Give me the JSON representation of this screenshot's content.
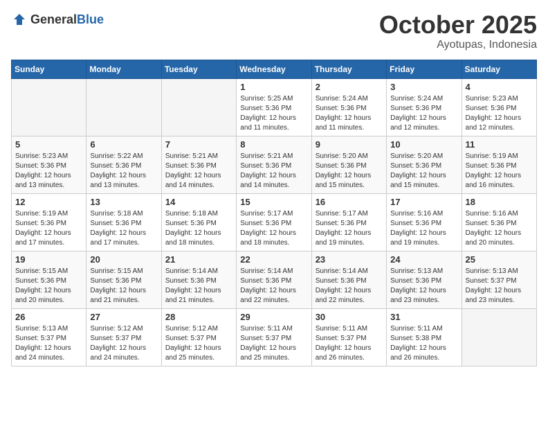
{
  "header": {
    "logo_general": "General",
    "logo_blue": "Blue",
    "month": "October 2025",
    "location": "Ayotupas, Indonesia"
  },
  "weekdays": [
    "Sunday",
    "Monday",
    "Tuesday",
    "Wednesday",
    "Thursday",
    "Friday",
    "Saturday"
  ],
  "weeks": [
    [
      {
        "day": "",
        "empty": true
      },
      {
        "day": "",
        "empty": true
      },
      {
        "day": "",
        "empty": true
      },
      {
        "day": "1",
        "sunrise": "5:25 AM",
        "sunset": "5:36 PM",
        "daylight": "12 hours and 11 minutes."
      },
      {
        "day": "2",
        "sunrise": "5:24 AM",
        "sunset": "5:36 PM",
        "daylight": "12 hours and 11 minutes."
      },
      {
        "day": "3",
        "sunrise": "5:24 AM",
        "sunset": "5:36 PM",
        "daylight": "12 hours and 12 minutes."
      },
      {
        "day": "4",
        "sunrise": "5:23 AM",
        "sunset": "5:36 PM",
        "daylight": "12 hours and 12 minutes."
      }
    ],
    [
      {
        "day": "5",
        "sunrise": "5:23 AM",
        "sunset": "5:36 PM",
        "daylight": "12 hours and 13 minutes."
      },
      {
        "day": "6",
        "sunrise": "5:22 AM",
        "sunset": "5:36 PM",
        "daylight": "12 hours and 13 minutes."
      },
      {
        "day": "7",
        "sunrise": "5:21 AM",
        "sunset": "5:36 PM",
        "daylight": "12 hours and 14 minutes."
      },
      {
        "day": "8",
        "sunrise": "5:21 AM",
        "sunset": "5:36 PM",
        "daylight": "12 hours and 14 minutes."
      },
      {
        "day": "9",
        "sunrise": "5:20 AM",
        "sunset": "5:36 PM",
        "daylight": "12 hours and 15 minutes."
      },
      {
        "day": "10",
        "sunrise": "5:20 AM",
        "sunset": "5:36 PM",
        "daylight": "12 hours and 15 minutes."
      },
      {
        "day": "11",
        "sunrise": "5:19 AM",
        "sunset": "5:36 PM",
        "daylight": "12 hours and 16 minutes."
      }
    ],
    [
      {
        "day": "12",
        "sunrise": "5:19 AM",
        "sunset": "5:36 PM",
        "daylight": "12 hours and 17 minutes."
      },
      {
        "day": "13",
        "sunrise": "5:18 AM",
        "sunset": "5:36 PM",
        "daylight": "12 hours and 17 minutes."
      },
      {
        "day": "14",
        "sunrise": "5:18 AM",
        "sunset": "5:36 PM",
        "daylight": "12 hours and 18 minutes."
      },
      {
        "day": "15",
        "sunrise": "5:17 AM",
        "sunset": "5:36 PM",
        "daylight": "12 hours and 18 minutes."
      },
      {
        "day": "16",
        "sunrise": "5:17 AM",
        "sunset": "5:36 PM",
        "daylight": "12 hours and 19 minutes."
      },
      {
        "day": "17",
        "sunrise": "5:16 AM",
        "sunset": "5:36 PM",
        "daylight": "12 hours and 19 minutes."
      },
      {
        "day": "18",
        "sunrise": "5:16 AM",
        "sunset": "5:36 PM",
        "daylight": "12 hours and 20 minutes."
      }
    ],
    [
      {
        "day": "19",
        "sunrise": "5:15 AM",
        "sunset": "5:36 PM",
        "daylight": "12 hours and 20 minutes."
      },
      {
        "day": "20",
        "sunrise": "5:15 AM",
        "sunset": "5:36 PM",
        "daylight": "12 hours and 21 minutes."
      },
      {
        "day": "21",
        "sunrise": "5:14 AM",
        "sunset": "5:36 PM",
        "daylight": "12 hours and 21 minutes."
      },
      {
        "day": "22",
        "sunrise": "5:14 AM",
        "sunset": "5:36 PM",
        "daylight": "12 hours and 22 minutes."
      },
      {
        "day": "23",
        "sunrise": "5:14 AM",
        "sunset": "5:36 PM",
        "daylight": "12 hours and 22 minutes."
      },
      {
        "day": "24",
        "sunrise": "5:13 AM",
        "sunset": "5:36 PM",
        "daylight": "12 hours and 23 minutes."
      },
      {
        "day": "25",
        "sunrise": "5:13 AM",
        "sunset": "5:37 PM",
        "daylight": "12 hours and 23 minutes."
      }
    ],
    [
      {
        "day": "26",
        "sunrise": "5:13 AM",
        "sunset": "5:37 PM",
        "daylight": "12 hours and 24 minutes."
      },
      {
        "day": "27",
        "sunrise": "5:12 AM",
        "sunset": "5:37 PM",
        "daylight": "12 hours and 24 minutes."
      },
      {
        "day": "28",
        "sunrise": "5:12 AM",
        "sunset": "5:37 PM",
        "daylight": "12 hours and 25 minutes."
      },
      {
        "day": "29",
        "sunrise": "5:11 AM",
        "sunset": "5:37 PM",
        "daylight": "12 hours and 25 minutes."
      },
      {
        "day": "30",
        "sunrise": "5:11 AM",
        "sunset": "5:37 PM",
        "daylight": "12 hours and 26 minutes."
      },
      {
        "day": "31",
        "sunrise": "5:11 AM",
        "sunset": "5:38 PM",
        "daylight": "12 hours and 26 minutes."
      },
      {
        "day": "",
        "empty": true
      }
    ]
  ]
}
